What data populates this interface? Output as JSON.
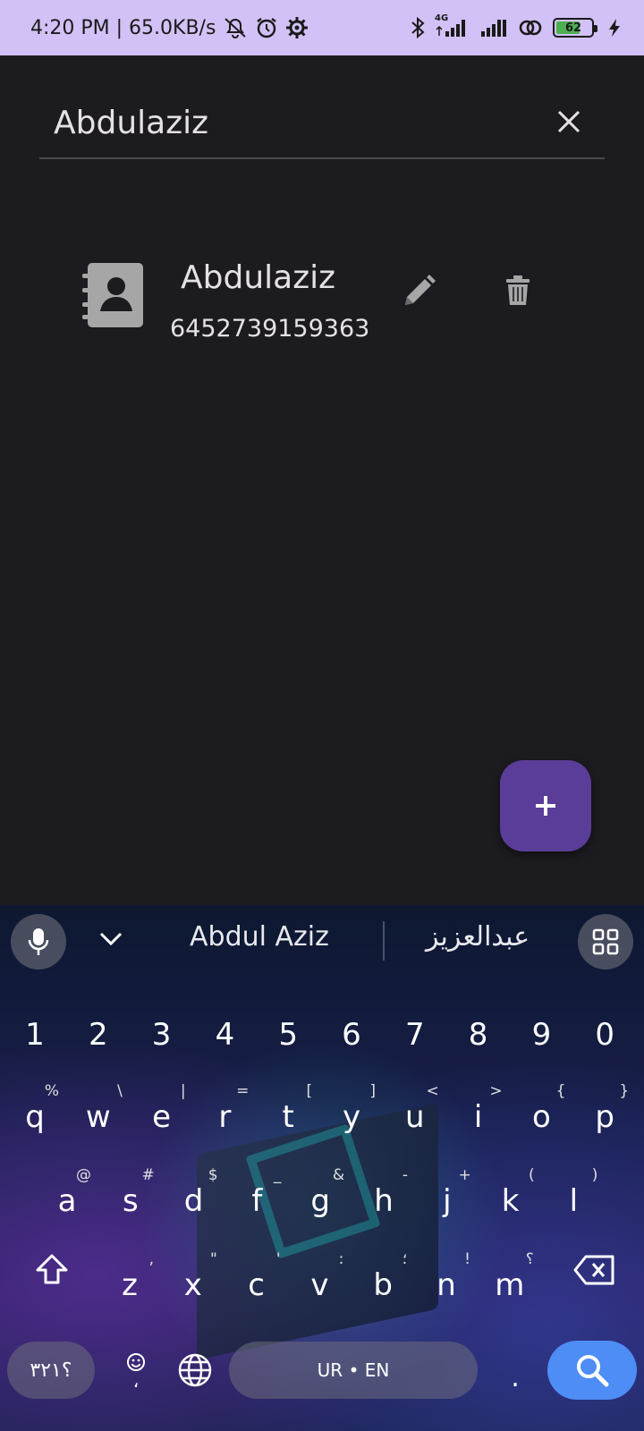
{
  "status_bar": {
    "time_speed": "4:20 PM | 65.0KB/s",
    "network_label": "4G",
    "battery": "62"
  },
  "search": {
    "value": "Abdulaziz"
  },
  "contact": {
    "name": "Abdulaziz",
    "phone": "6452739159363"
  },
  "keyboard": {
    "suggestions": [
      "Abdul Aziz",
      "عبدالعزيز"
    ],
    "numbers": [
      "1",
      "2",
      "3",
      "4",
      "5",
      "6",
      "7",
      "8",
      "9",
      "0"
    ],
    "row1": [
      {
        "k": "q",
        "h": "%"
      },
      {
        "k": "w",
        "h": "\\"
      },
      {
        "k": "e",
        "h": "|"
      },
      {
        "k": "r",
        "h": "="
      },
      {
        "k": "t",
        "h": "["
      },
      {
        "k": "y",
        "h": "]"
      },
      {
        "k": "u",
        "h": "<"
      },
      {
        "k": "i",
        "h": ">"
      },
      {
        "k": "o",
        "h": "{"
      },
      {
        "k": "p",
        "h": "}"
      }
    ],
    "row2": [
      {
        "k": "a",
        "h": "@"
      },
      {
        "k": "s",
        "h": "#"
      },
      {
        "k": "d",
        "h": "$"
      },
      {
        "k": "f",
        "h": "_"
      },
      {
        "k": "g",
        "h": "&"
      },
      {
        "k": "h",
        "h": "-"
      },
      {
        "k": "j",
        "h": "+"
      },
      {
        "k": "k",
        "h": "("
      },
      {
        "k": "l",
        "h": ")"
      }
    ],
    "row3": [
      {
        "k": "z",
        "h": ","
      },
      {
        "k": "x",
        "h": "\""
      },
      {
        "k": "c",
        "h": "'"
      },
      {
        "k": "v",
        "h": ":"
      },
      {
        "k": "b",
        "h": "؛"
      },
      {
        "k": "n",
        "h": "!"
      },
      {
        "k": "m",
        "h": "؟"
      }
    ],
    "symbols_label": "؟٣٢١",
    "space_label": "UR • EN",
    "emoji_hint": "،",
    "period_label": "."
  },
  "colors": {
    "background": "#1c1b20",
    "status_bar": "#d2c1f6",
    "fab": "#5a3d98",
    "search_key": "#4d8df5"
  }
}
